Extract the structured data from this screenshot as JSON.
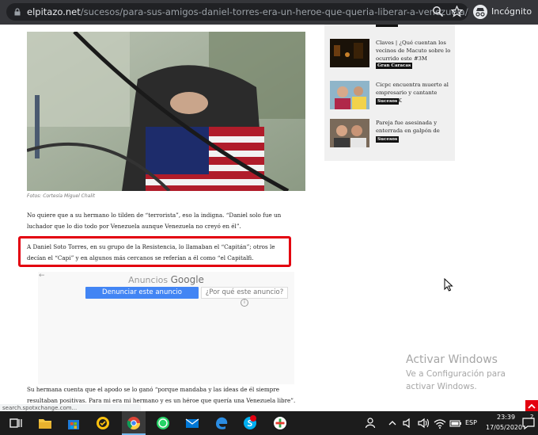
{
  "browser": {
    "url_host": "elpitazo.net",
    "url_path": "/sucesos/para-sus-amigos-daniel-torres-era-un-heroe-que-queria-liberar-a-venezuela/",
    "incognito_label": "Incógnito"
  },
  "article": {
    "photo_caption": "Fotos: Cortesía Miguel Chalit",
    "paragraphs": [
      "No quiere que a su hermano lo tilden de “terrorista”, eso la indigna. “Daniel solo fue un luchador que lo dio todo por Venezuela aunque Venezuela no creyó en él”.",
      "A Daniel Soto Torres, en su grupo de la Resistencia, lo llamaban el “Capitán”; otros le decían el “Capi” y en algunos más cercanos se referían a él como “el Capitalfi.",
      "Su hermana cuenta que el apodo se lo ganó “porque mandaba y las ideas de él siempre resultaban positivas. Para mi era mi hermano y es un héroe que quería una Venezuela libre”."
    ]
  },
  "ad": {
    "back_glyph": "←",
    "anuncios": "Anuncios",
    "google": "Google",
    "stop_button": "Denunciar este anuncio",
    "why_button": "¿Por qué este anuncio?",
    "info_glyph": "i"
  },
  "sidebar": {
    "items": [
      {
        "title": "Claves | ¿Qué cuentan los vecinos de Macuto sobre lo ocurrido este #3M",
        "tag": "Gran Caracas"
      },
      {
        "title": "Cicpc encuentra muerto al empresario y cantante Alberto K",
        "tag": "Sucesos"
      },
      {
        "title": "Pareja fue asesinada y enterrada en galpón de Valencia",
        "tag": "Sucesos"
      }
    ]
  },
  "watermark": {
    "line1": "Activar Windows",
    "line2": "Ve a Configuración para activar Windows."
  },
  "status_url": "search.spotxchange.com...",
  "taskbar": {
    "language": "ESP",
    "time": "23:39",
    "date": "17/05/2020",
    "notification_count": "2"
  },
  "colors": {
    "highlight_border": "#e3000f",
    "ad_blue": "#4285f4"
  }
}
